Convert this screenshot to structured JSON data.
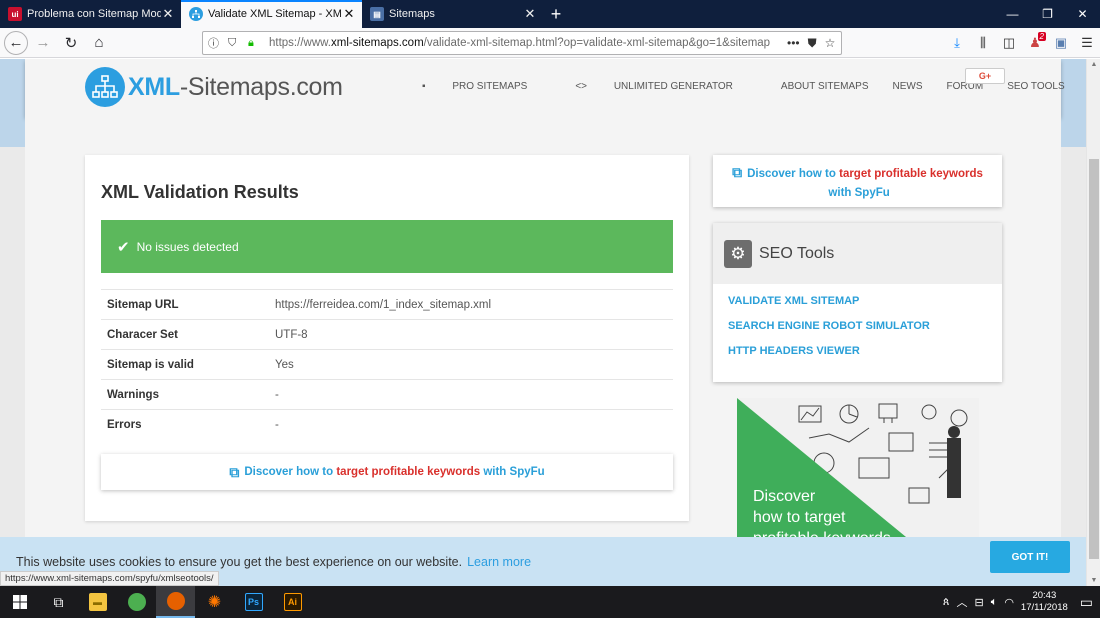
{
  "browser": {
    "tabs": [
      {
        "title": "Problema con Sitemap Modulo",
        "favicon": "ui-favicon",
        "favicon_color": "#c8102e",
        "active": false
      },
      {
        "title": "Validate XML Sitemap - XML Si",
        "favicon": "sitemap-favicon",
        "favicon_color": "#2c9ee0",
        "active": true
      },
      {
        "title": "Sitemaps",
        "favicon": "folder-favicon",
        "favicon_color": "#4a6fa5",
        "active": false
      }
    ],
    "url_prefix": "https://www.",
    "url_domain": "xml-sitemaps.com",
    "url_path": "/validate-xml-sitemap.html?op=validate-xml-sitemap&go=1&sitemap",
    "notification_badge": "2"
  },
  "site": {
    "logo_xml": "XML",
    "logo_rest": "-Sitemaps.com",
    "nav": [
      "PRO SITEMAPS",
      "UNLIMITED GENERATOR",
      "ABOUT SITEMAPS",
      "NEWS",
      "FORUM",
      "SEO TOOLS"
    ],
    "gplus_label": "G+",
    "brand_color": "#2c9ee0"
  },
  "results": {
    "heading": "XML Validation Results",
    "status_message": "No issues detected",
    "success_color": "#5cb85c",
    "rows": [
      {
        "label": "Sitemap URL",
        "value": "https://ferreidea.com/1_index_sitemap.xml"
      },
      {
        "label": "Characer Set",
        "value": "UTF-8"
      },
      {
        "label": "Sitemap is valid",
        "value": "Yes"
      },
      {
        "label": "Warnings",
        "value": "-"
      },
      {
        "label": "Errors",
        "value": "-"
      }
    ],
    "spyfu": {
      "pre": "Discover how to ",
      "highlight": "target profitable keywords",
      "post": " with SpyFu"
    }
  },
  "sidebar": {
    "spyfu": {
      "pre": "Discover how to ",
      "highlight": "target profitable keywords",
      "post": " with SpyFu"
    },
    "seo_tools_title": "SEO Tools",
    "seo_links": [
      "VALIDATE XML SITEMAP",
      "SEARCH ENGINE ROBOT SIMULATOR",
      "HTTP HEADERS VIEWER"
    ],
    "ad_lines": [
      "Discover",
      "how to target",
      "profitable keywords"
    ]
  },
  "cookie": {
    "message": "This website uses cookies to ensure you get the best experience on our website.",
    "learn_more": "Learn more",
    "button": "GOT IT!"
  },
  "status_url": "https://www.xml-sitemaps.com/spyfu/xmlseotools/",
  "taskbar": {
    "time": "20:43",
    "date": "17/11/2018",
    "apps": [
      "start-icon",
      "task-view-icon",
      "file-explorer-icon",
      "chrome-icon",
      "firefox-icon",
      "avast-icon",
      "photoshop-icon",
      "illustrator-icon"
    ],
    "ps_label": "Ps",
    "ai_label": "Ai"
  }
}
